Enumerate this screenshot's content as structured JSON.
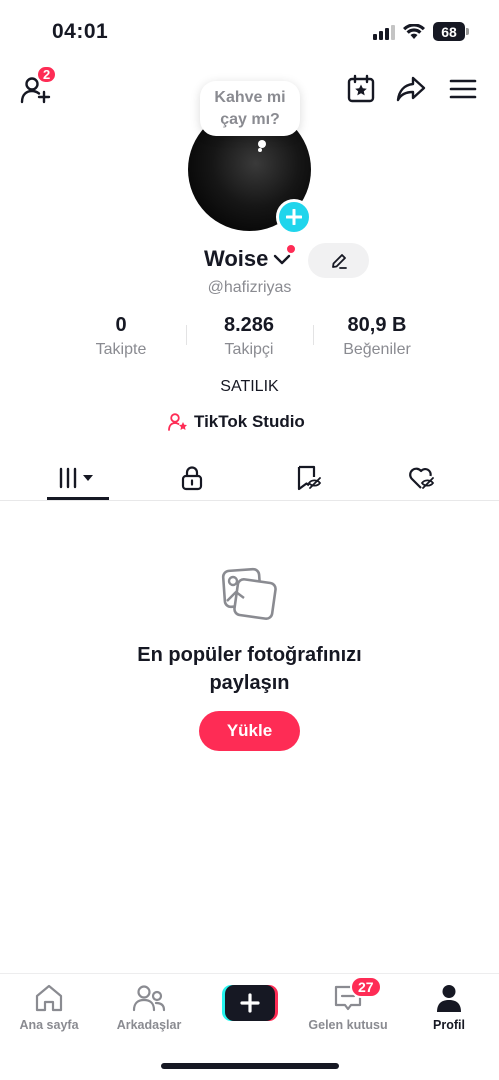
{
  "status_bar": {
    "time": "04:01",
    "battery": "68"
  },
  "header": {
    "add_friends_badge": "2",
    "icons": [
      "add-friend-icon",
      "calendar-star-icon",
      "share-icon",
      "menu-icon"
    ]
  },
  "profile": {
    "note": "Kahve mi çay mı?",
    "display_name": "Woise",
    "handle": "@hafizriyas",
    "stats": [
      {
        "value": "0",
        "label": "Takipte"
      },
      {
        "value": "8.286",
        "label": "Takipçi"
      },
      {
        "value": "80,9 B",
        "label": "Beğeniler"
      }
    ],
    "bio": "SATILIK",
    "studio_link": "TikTok Studio"
  },
  "tabs": [
    "videos-tab",
    "private-tab",
    "reposts-tab",
    "liked-tab"
  ],
  "empty_state": {
    "title_line1": "En popüler fotoğrafınızı",
    "title_line2": "paylaşın",
    "button": "Yükle"
  },
  "bottom_nav": {
    "items": [
      {
        "label": "Ana sayfa"
      },
      {
        "label": "Arkadaşlar"
      },
      {
        "label": "Gelen kutusu",
        "badge": "27"
      },
      {
        "label": "Profil"
      }
    ]
  },
  "colors": {
    "accent": "#fe2c55",
    "cyan": "#20d5ec",
    "text": "#161823",
    "muted": "#8a8b91"
  }
}
